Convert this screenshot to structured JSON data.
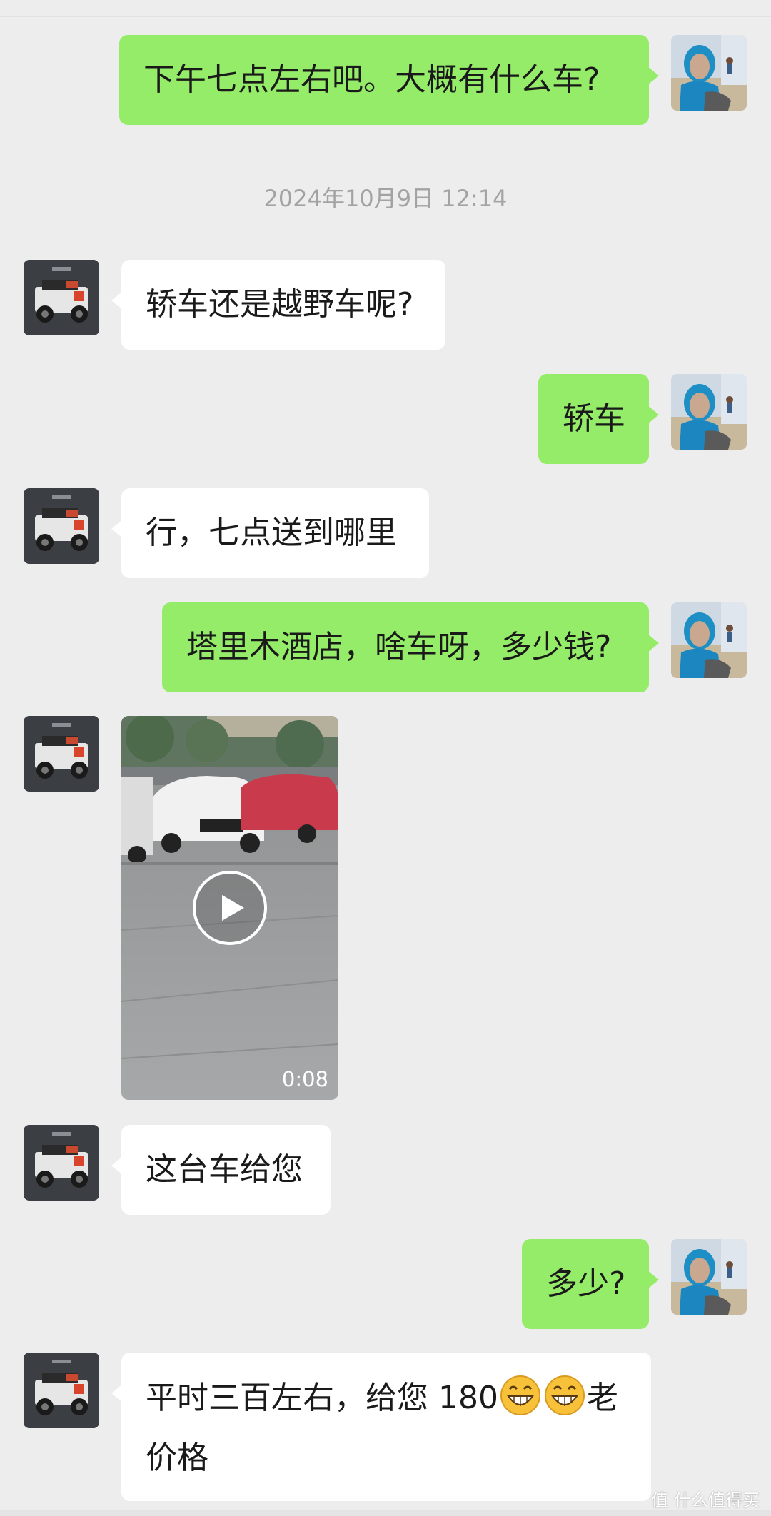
{
  "timestamp": "2024年10月9日 12:14",
  "messages": [
    {
      "side": "right",
      "text": "下午七点左右吧。大概有什么车?"
    },
    {
      "side": "left",
      "text": "轿车还是越野车呢?"
    },
    {
      "side": "right",
      "text": "轿车"
    },
    {
      "side": "left",
      "text": "行，七点送到哪里"
    },
    {
      "side": "right",
      "text": "塔里木酒店，啥车呀，多少钱?"
    },
    {
      "side": "left",
      "type": "video",
      "duration": "0:08"
    },
    {
      "side": "left",
      "text": "这台车给您"
    },
    {
      "side": "right",
      "text": "多少?"
    },
    {
      "side": "left",
      "line1_before": "平时三百左右，给您 180",
      "line1_after": "老",
      "line2": "价格",
      "emoji": "grinning-face"
    }
  ],
  "watermark": "值 什么值得买",
  "colors": {
    "sent_bubble": "#95ec69",
    "received_bubble": "#ffffff",
    "background": "#ededed"
  }
}
